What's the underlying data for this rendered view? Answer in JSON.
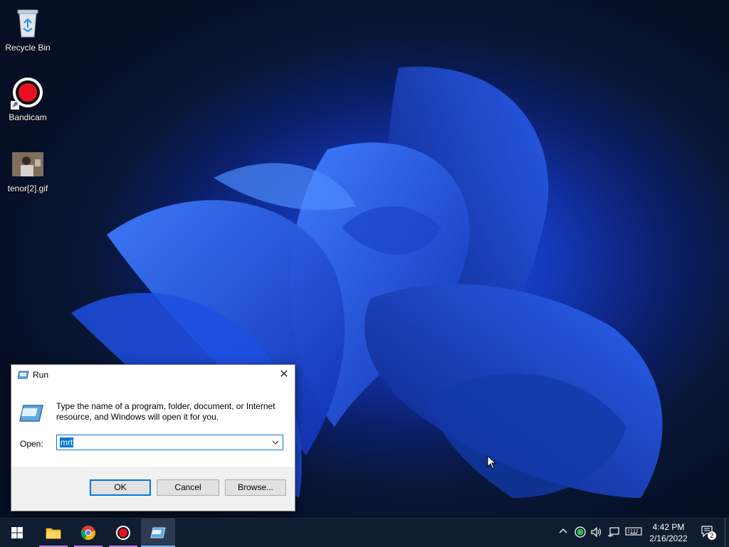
{
  "desktop": {
    "icons": [
      {
        "label": "Recycle Bin",
        "icon": "recycle-bin-icon"
      },
      {
        "label": "Bandicam",
        "icon": "bandicam-icon"
      },
      {
        "label": "tenor[2].gif",
        "icon": "gif-thumbnail-icon"
      }
    ]
  },
  "run_dialog": {
    "title": "Run",
    "description": "Type the name of a program, folder, document, or Internet resource, and Windows will open it for you.",
    "open_label": "Open:",
    "open_value": "mrt",
    "ok_label": "OK",
    "cancel_label": "Cancel",
    "browse_label": "Browse..."
  },
  "taskbar": {
    "apps": [
      "windows-start-icon",
      "file-explorer-icon",
      "chrome-icon",
      "bandicam-icon",
      "run-icon"
    ],
    "tray": [
      "chevron-up-icon",
      "bandicam-tray-icon",
      "volume-icon",
      "network-icon",
      "keyboard-icon"
    ],
    "time": "4:42 PM",
    "date": "2/16/2022",
    "notification_count": "2"
  },
  "colors": {
    "accent": "#0078d7",
    "taskbar": "#101c30",
    "bandicam_red": "#e81123"
  }
}
